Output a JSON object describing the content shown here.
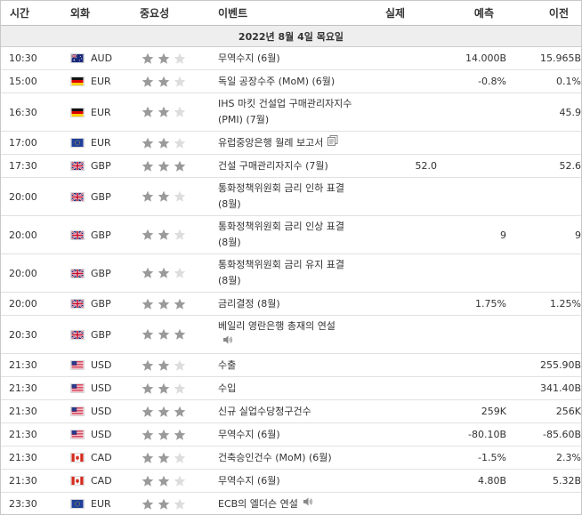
{
  "headers": {
    "time": "시간",
    "currency": "외화",
    "importance": "중요성",
    "event": "이벤트",
    "actual": "실제",
    "forecast": "예측",
    "previous": "이전"
  },
  "date_label": "2022년 8월 4일 목요일",
  "colors": {
    "star_filled": "#9a9a9a",
    "star_empty": "#dddddd",
    "header_bg": "#eeeeee",
    "border": "#e1e1e1"
  },
  "rows": [
    {
      "time": "10:30",
      "flag": "au-flag",
      "currency": "AUD",
      "stars": 2,
      "event": "무역수지 (6월)",
      "event_line2": "",
      "icon": "",
      "actual": "",
      "forecast": "14.000B",
      "previous": "15.965B"
    },
    {
      "time": "15:00",
      "flag": "de-flag",
      "currency": "EUR",
      "stars": 2,
      "event": "독일 공장수주 (MoM) (6월)",
      "event_line2": "",
      "icon": "",
      "actual": "",
      "forecast": "-0.8%",
      "previous": "0.1%"
    },
    {
      "time": "16:30",
      "flag": "de-flag",
      "currency": "EUR",
      "stars": 2,
      "event": "IHS 마킷 건설업 구매관리자지수",
      "event_line2": "(PMI) (7월)",
      "icon": "",
      "actual": "",
      "forecast": "",
      "previous": "45.9"
    },
    {
      "time": "17:00",
      "flag": "eu-flag",
      "currency": "EUR",
      "stars": 2,
      "event": "유럽중앙은행 월례 보고서",
      "event_line2": "",
      "icon": "document-icon",
      "actual": "",
      "forecast": "",
      "previous": ""
    },
    {
      "time": "17:30",
      "flag": "gb-flag",
      "currency": "GBP",
      "stars": 3,
      "event": "건설 구매관리자지수 (7월)",
      "event_line2": "",
      "icon": "",
      "actual": "52.0",
      "forecast": "",
      "previous": "52.6"
    },
    {
      "time": "20:00",
      "flag": "gb-flag",
      "currency": "GBP",
      "stars": 2,
      "event": "통화정책위원회 금리 인하 표결",
      "event_line2": "(8월)",
      "icon": "",
      "actual": "",
      "forecast": "",
      "previous": ""
    },
    {
      "time": "20:00",
      "flag": "gb-flag",
      "currency": "GBP",
      "stars": 2,
      "event": "통화정책위원회 금리 인상 표결",
      "event_line2": "(8월)",
      "icon": "",
      "actual": "",
      "forecast": "9",
      "previous": "9"
    },
    {
      "time": "20:00",
      "flag": "gb-flag",
      "currency": "GBP",
      "stars": 2,
      "event": "통화정책위원회 금리 유지 표결",
      "event_line2": "(8월)",
      "icon": "",
      "actual": "",
      "forecast": "",
      "previous": ""
    },
    {
      "time": "20:00",
      "flag": "gb-flag",
      "currency": "GBP",
      "stars": 3,
      "event": "금리결정 (8월)",
      "event_line2": "",
      "icon": "",
      "actual": "",
      "forecast": "1.75%",
      "previous": "1.25%"
    },
    {
      "time": "20:30",
      "flag": "gb-flag",
      "currency": "GBP",
      "stars": 3,
      "event": "베일리 영란은행 총재의 연설",
      "event_line2": "",
      "icon": "speaker-icon",
      "actual": "",
      "forecast": "",
      "previous": ""
    },
    {
      "time": "21:30",
      "flag": "us-flag",
      "currency": "USD",
      "stars": 2,
      "event": "수출",
      "event_line2": "",
      "icon": "",
      "actual": "",
      "forecast": "",
      "previous": "255.90B"
    },
    {
      "time": "21:30",
      "flag": "us-flag",
      "currency": "USD",
      "stars": 2,
      "event": "수입",
      "event_line2": "",
      "icon": "",
      "actual": "",
      "forecast": "",
      "previous": "341.40B"
    },
    {
      "time": "21:30",
      "flag": "us-flag",
      "currency": "USD",
      "stars": 3,
      "event": "신규 실업수당청구건수",
      "event_line2": "",
      "icon": "",
      "actual": "",
      "forecast": "259K",
      "previous": "256K"
    },
    {
      "time": "21:30",
      "flag": "us-flag",
      "currency": "USD",
      "stars": 3,
      "event": "무역수지 (6월)",
      "event_line2": "",
      "icon": "",
      "actual": "",
      "forecast": "-80.10B",
      "previous": "-85.60B"
    },
    {
      "time": "21:30",
      "flag": "ca-flag",
      "currency": "CAD",
      "stars": 2,
      "event": "건축승인건수 (MoM) (6월)",
      "event_line2": "",
      "icon": "",
      "actual": "",
      "forecast": "-1.5%",
      "previous": "2.3%"
    },
    {
      "time": "21:30",
      "flag": "ca-flag",
      "currency": "CAD",
      "stars": 2,
      "event": "무역수지 (6월)",
      "event_line2": "",
      "icon": "",
      "actual": "",
      "forecast": "4.80B",
      "previous": "5.32B"
    },
    {
      "time": "23:30",
      "flag": "eu-flag",
      "currency": "EUR",
      "stars": 2,
      "event": "ECB의 엘더슨 연설",
      "event_line2": "",
      "icon": "speaker-icon",
      "actual": "",
      "forecast": "",
      "previous": ""
    }
  ]
}
